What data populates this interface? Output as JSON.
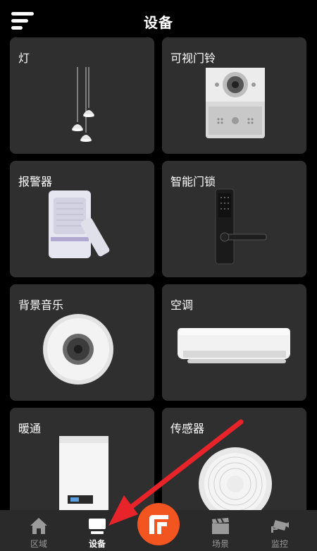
{
  "header": {
    "title": "设备"
  },
  "devices": [
    {
      "label": "灯"
    },
    {
      "label": "可视门铃"
    },
    {
      "label": "报警器"
    },
    {
      "label": "智能门锁"
    },
    {
      "label": "背景音乐"
    },
    {
      "label": "空调"
    },
    {
      "label": "暖通"
    },
    {
      "label": "传感器"
    }
  ],
  "tabbar": {
    "tabs": [
      {
        "label": "区域",
        "icon": "home-icon"
      },
      {
        "label": "设备",
        "icon": "monitor-icon",
        "active": true
      },
      {
        "label": "场景",
        "icon": "clapperboard-icon"
      },
      {
        "label": "监控",
        "icon": "camera-icon"
      }
    ],
    "center_icon": "f-logo-icon"
  },
  "colors": {
    "accent": "#f2551f",
    "card": "#2f2f2f",
    "background": "#000000",
    "annotation_arrow": "#e8242a"
  }
}
